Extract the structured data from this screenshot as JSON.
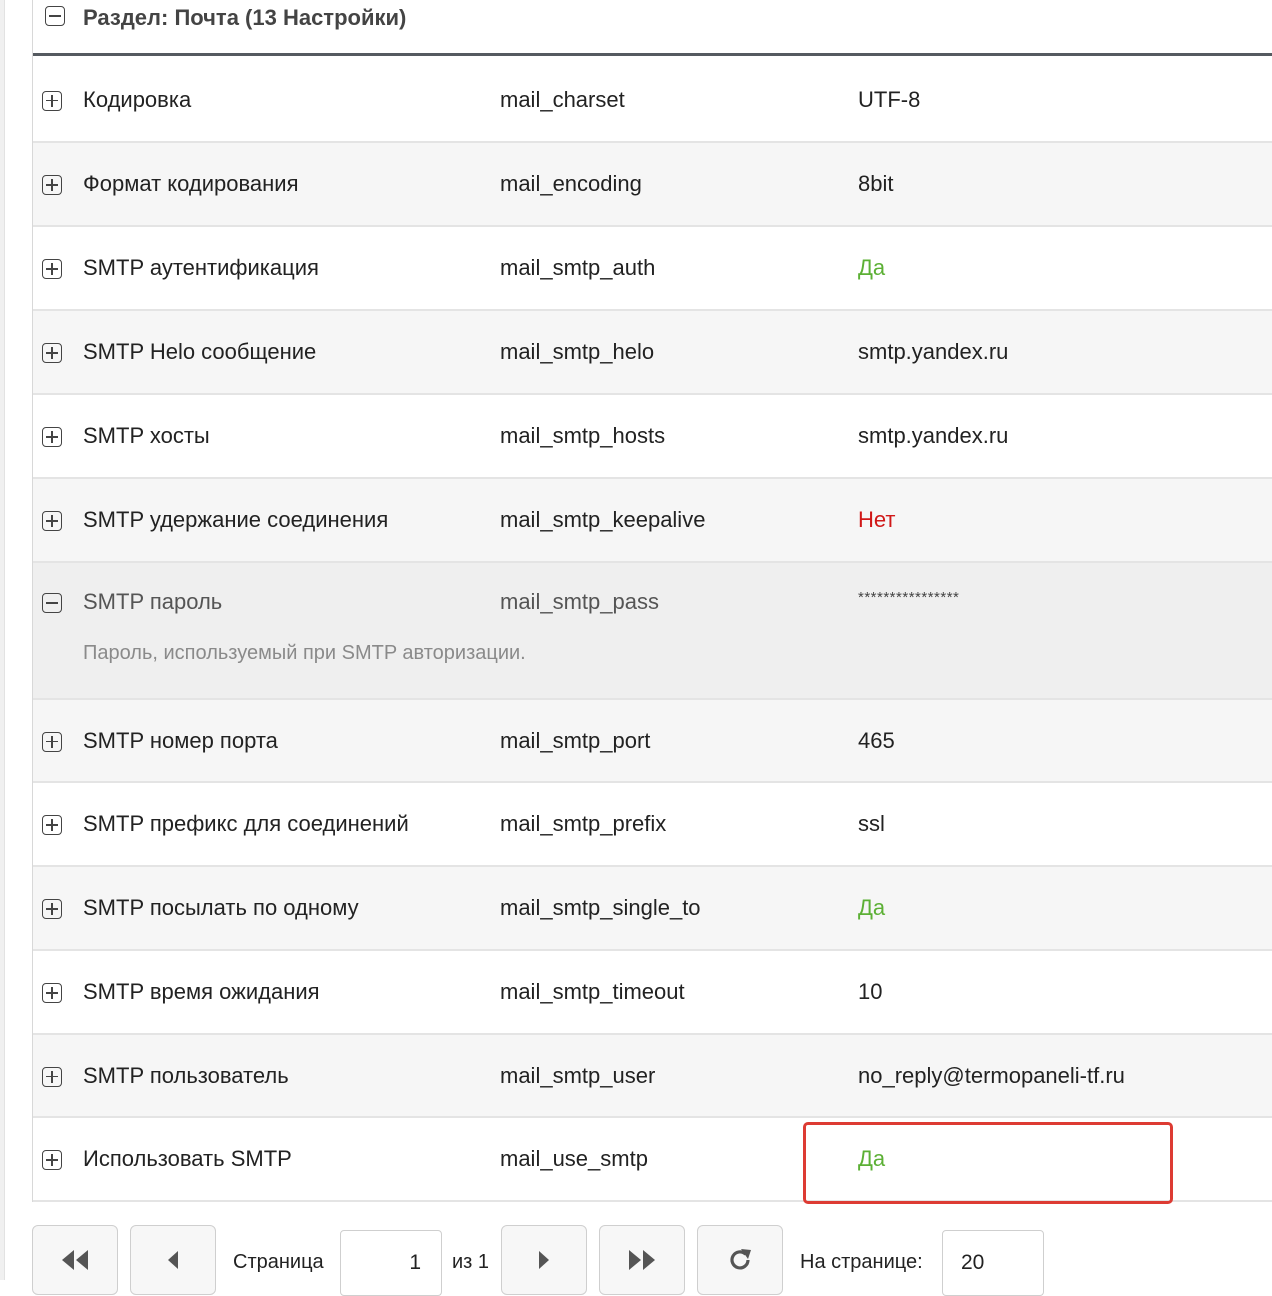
{
  "section": {
    "title": "Раздел: Почта (13 Настройки)"
  },
  "rows": [
    {
      "name": "Кодировка",
      "key": "mail_charset",
      "value": "UTF-8",
      "kind": "text"
    },
    {
      "name": "Формат кодирования",
      "key": "mail_encoding",
      "value": "8bit",
      "kind": "text"
    },
    {
      "name": "SMTP аутентификация",
      "key": "mail_smtp_auth",
      "value": "Да",
      "kind": "yes"
    },
    {
      "name": "SMTP Helo сообщение",
      "key": "mail_smtp_helo",
      "value": "smtp.yandex.ru",
      "kind": "text"
    },
    {
      "name": "SMTP хосты",
      "key": "mail_smtp_hosts",
      "value": "smtp.yandex.ru",
      "kind": "text"
    },
    {
      "name": "SMTP удержание соединения",
      "key": "mail_smtp_keepalive",
      "value": "Нет",
      "kind": "no"
    },
    {
      "name": "SMTP пароль",
      "key": "mail_smtp_pass",
      "value": "****************",
      "kind": "masked",
      "expanded": true,
      "description": "Пароль, используемый при SMTP авторизации."
    },
    {
      "name": "SMTP номер порта",
      "key": "mail_smtp_port",
      "value": "465",
      "kind": "text"
    },
    {
      "name": "SMTP префикс для соединений",
      "key": "mail_smtp_prefix",
      "value": "ssl",
      "kind": "text"
    },
    {
      "name": "SMTP посылать по одному",
      "key": "mail_smtp_single_to",
      "value": "Да",
      "kind": "yes"
    },
    {
      "name": "SMTP время ожидания",
      "key": "mail_smtp_timeout",
      "value": "10",
      "kind": "text"
    },
    {
      "name": "SMTP пользователь",
      "key": "mail_smtp_user",
      "value": "no_reply@termopaneli-tf.ru",
      "kind": "text"
    },
    {
      "name": "Использовать SMTP",
      "key": "mail_use_smtp",
      "value": "Да",
      "kind": "yes"
    }
  ],
  "pagination": {
    "page_label": "Страница",
    "page_value": "1",
    "of_label": "из 1",
    "per_page_label": "На странице:",
    "per_page_value": "20"
  },
  "colors": {
    "yes": "#5cb035",
    "no": "#d01818",
    "highlight": "#dd3b33",
    "header_rule": "#555a60"
  }
}
